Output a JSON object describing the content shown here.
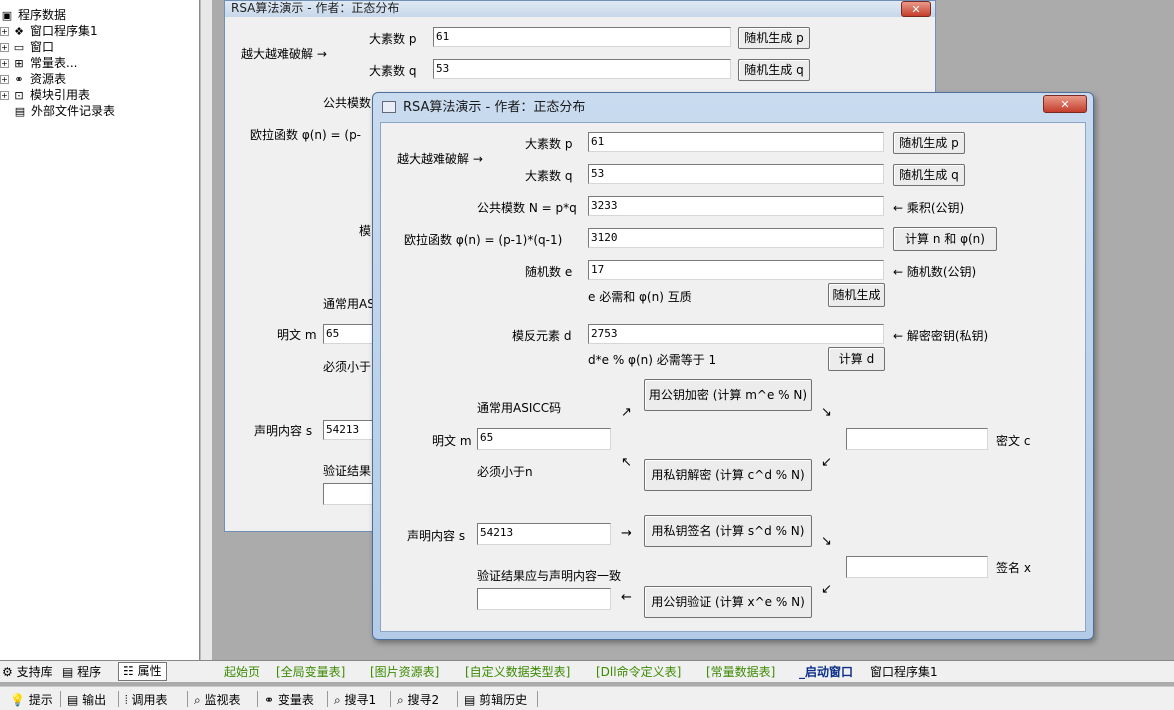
{
  "tree": {
    "items": [
      {
        "label": "程序数据",
        "icon": "data-icon"
      },
      {
        "label": "窗口程序集1",
        "icon": "assembly-icon"
      },
      {
        "label": "窗口",
        "icon": "window-icon"
      },
      {
        "label": "常量表...",
        "icon": "constant-icon"
      },
      {
        "label": "资源表",
        "icon": "resource-icon"
      },
      {
        "label": "模块引用表",
        "icon": "module-icon"
      },
      {
        "label": "外部文件记录表",
        "icon": "file-icon"
      }
    ]
  },
  "back": {
    "title": "RSA算法演示 - 作者：正态分布",
    "close": "✕",
    "hint": "越大越难破解 →",
    "p_label": "大素数 p",
    "q_label": "大素数 q",
    "p_value": "61",
    "q_value": "53",
    "gen_p": "随机生成 p",
    "gen_q": "随机生成 q",
    "n_label": "公共模数",
    "phi_label": "欧拉函数 φ(n) = (p-",
    "mod_label": "模",
    "asicc": "通常用ASI",
    "m_label": "明文 m",
    "m_value": "65",
    "must_less": "必须小于",
    "s_label": "声明内容 s",
    "s_value": "54213",
    "verify": "验证结果",
    "blank": ""
  },
  "front": {
    "title": "RSA算法演示 - 作者：正态分布",
    "close": "✕",
    "hint": "越大越难破解 →",
    "p_label": "大素数 p",
    "p_value": "61",
    "gen_p": "随机生成 p",
    "q_label": "大素数 q",
    "q_value": "53",
    "gen_q": "随机生成 q",
    "n_label": "公共模数 N = p*q",
    "n_value": "3233",
    "n_note": "← 乘积(公钥)",
    "phi_label": "欧拉函数 φ(n) = (p-1)*(q-1)",
    "phi_value": "3120",
    "calc_n_phi": "计算 n 和 φ(n)",
    "e_label": "随机数 e",
    "e_value": "17",
    "e_note": "← 随机数(公钥)",
    "e_hint": "e 必需和 φ(n) 互质",
    "gen_e": "随机生成",
    "d_label": "模反元素 d",
    "d_value": "2753",
    "d_note": "← 解密密钥(私钥)",
    "d_hint": "d*e % φ(n) 必需等于 1",
    "calc_d": "计算 d",
    "asicc": "通常用ASICC码",
    "encrypt": "用公钥加密 (计算 m^e % N)",
    "decrypt": "用私钥解密 (计算 c^d % N)",
    "m_label": "明文 m",
    "m_value": "65",
    "must_less": "必须小于n",
    "c_value": "",
    "c_label": "密文 c",
    "s_label": "声明内容 s",
    "s_value": "54213",
    "sign": "用私钥签名 (计算 s^d % N)",
    "x_value": "",
    "x_label": "签名 x",
    "verify_hint": "验证结果应与声明内容一致",
    "verify_value": "",
    "verify": "用公钥验证 (计算 x^e % N)",
    "arrow_ne": "↗",
    "arrow_se": "↘",
    "arrow_sw": "↙",
    "arrow_nw": "↖",
    "arrow_right": "→",
    "arrow_left": "←",
    "arrow_se2": "↘",
    "arrow_sw2": "↙"
  },
  "left_tabs": {
    "support": "支持库",
    "program": "程序",
    "property": "属性"
  },
  "doc_tabs": [
    "起始页",
    "[全局变量表]",
    "[图片资源表]",
    "[自定义数据类型表]",
    "[Dll命令定义表]",
    "[常量数据表]",
    "_启动窗口",
    "窗口程序集1"
  ],
  "status": [
    "提示",
    "输出",
    "调用表",
    "监视表",
    "变量表",
    "搜寻1",
    "搜寻2",
    "剪辑历史"
  ],
  "colors": {
    "tab_green": "#3a8a00",
    "tab_blue": "#0b2f8a",
    "close_red": "#c43d2b"
  }
}
